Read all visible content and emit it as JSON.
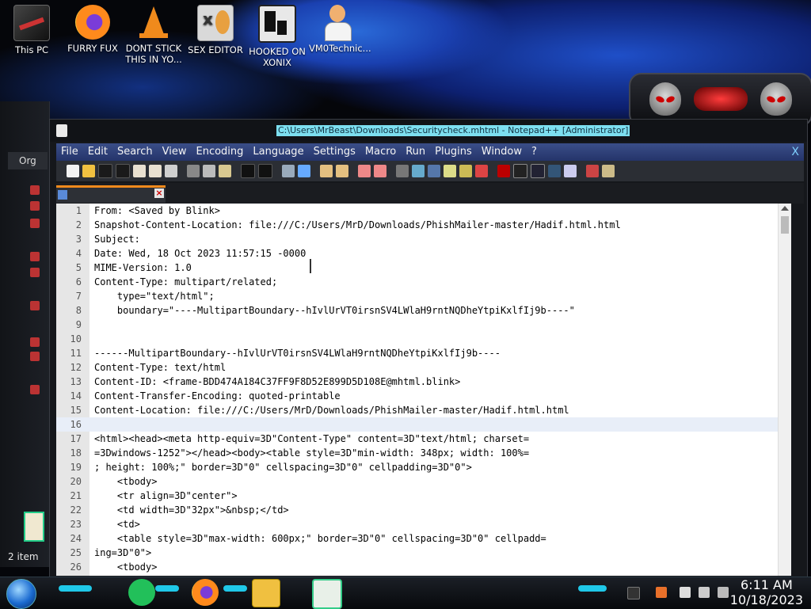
{
  "desktop": {
    "icons": [
      {
        "label": "This PC"
      },
      {
        "label": "FURRY FUX"
      },
      {
        "label": "DONT STICK THIS IN YO..."
      },
      {
        "label": "SEX EDITOR"
      },
      {
        "label": "HOOKED ON XONIX"
      },
      {
        "label": "VM0Technic..."
      }
    ]
  },
  "explorer": {
    "tab_label": "Org",
    "status": "2 item"
  },
  "window": {
    "title": "C:\\Users\\MrBeast\\Downloads\\Securitycheck.mhtml - Notepad++ [Administrator]",
    "menu": [
      "File",
      "Edit",
      "Search",
      "View",
      "Encoding",
      "Language",
      "Settings",
      "Macro",
      "Run",
      "Plugins",
      "Window",
      "?"
    ],
    "close_label": "X",
    "tab_label": ""
  },
  "editor": {
    "lines": [
      {
        "n": "1",
        "t": "From: <Saved by Blink>"
      },
      {
        "n": "2",
        "t": "Snapshot-Content-Location: file:///C:/Users/MrD/Downloads/PhishMailer-master/Hadif.html.html"
      },
      {
        "n": "3",
        "t": "Subject:"
      },
      {
        "n": "4",
        "t": "Date: Wed, 18 Oct 2023 11:57:15 -0000"
      },
      {
        "n": "5",
        "t": "MIME-Version: 1.0"
      },
      {
        "n": "6",
        "t": "Content-Type: multipart/related;"
      },
      {
        "n": "7",
        "t": "    type=\"text/html\";"
      },
      {
        "n": "8",
        "t": "    boundary=\"----MultipartBoundary--hIvlUrVT0irsnSV4LWlaH9rntNQDheYtpiKxlfIj9b----\""
      },
      {
        "n": "9",
        "t": ""
      },
      {
        "n": "10",
        "t": ""
      },
      {
        "n": "11",
        "t": "------MultipartBoundary--hIvlUrVT0irsnSV4LWlaH9rntNQDheYtpiKxlfIj9b----"
      },
      {
        "n": "12",
        "t": "Content-Type: text/html"
      },
      {
        "n": "13",
        "t": "Content-ID: <frame-BDD474A184C37FF9F8D52E899D5D108E@mhtml.blink>"
      },
      {
        "n": "14",
        "t": "Content-Transfer-Encoding: quoted-printable"
      },
      {
        "n": "15",
        "t": "Content-Location: file:///C:/Users/MrD/Downloads/PhishMailer-master/Hadif.html.html"
      },
      {
        "n": "16",
        "t": ""
      },
      {
        "n": "17",
        "t": "<html><head><meta http-equiv=3D\"Content-Type\" content=3D\"text/html; charset="
      },
      {
        "n": "18",
        "t": "=3Dwindows-1252\"></head><body><table style=3D\"min-width: 348px; width: 100%="
      },
      {
        "n": "19",
        "t": "; height: 100%;\" border=3D\"0\" cellspacing=3D\"0\" cellpadding=3D\"0\">"
      },
      {
        "n": "20",
        "t": "    <tbody>"
      },
      {
        "n": "21",
        "t": "    <tr align=3D\"center\">"
      },
      {
        "n": "22",
        "t": "    <td width=3D\"32px\">&nbsp;</td>"
      },
      {
        "n": "23",
        "t": "    <td>"
      },
      {
        "n": "24",
        "t": "    <table style=3D\"max-width: 600px;\" border=3D\"0\" cellspacing=3D\"0\" cellpadd="
      },
      {
        "n": "25",
        "t": "ing=3D\"0\">"
      },
      {
        "n": "26",
        "t": "    <tbody>"
      }
    ],
    "current_line": 16
  },
  "taskbar": {
    "time": "6:11 AM",
    "date": "10/18/2023"
  },
  "colors": {
    "menubar": "#2f4179",
    "title_highlight": "#7ddff0",
    "tab_accent": "#f08a1c",
    "taskbar_glow": "#1fc8e8"
  }
}
